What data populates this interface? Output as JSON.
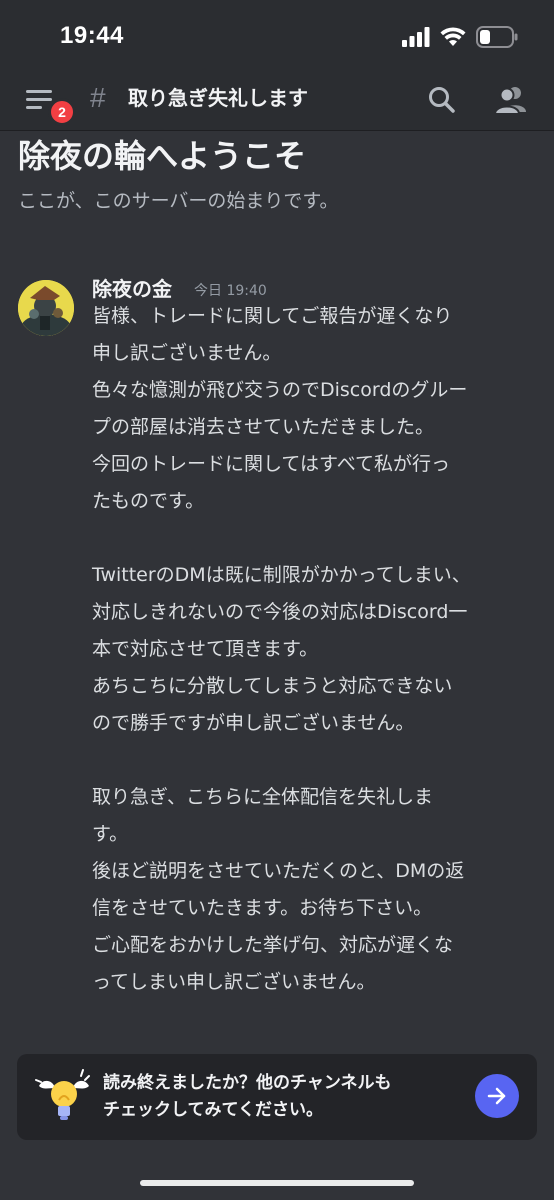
{
  "status_bar": {
    "time": "19:44"
  },
  "header": {
    "menu_badge": "2",
    "hash": "#",
    "channel_name": "取り急ぎ失礼します"
  },
  "welcome": {
    "title": "除夜の輪へようこそ",
    "subtitle": "ここが、このサーバーの始まりです。"
  },
  "message": {
    "author": "除夜の金",
    "timestamp": "今日 19:40",
    "lines": [
      "皆様、トレードに関してご報告が遅くなり",
      "申し訳ございません。",
      "色々な憶測が飛び交うのでDiscordのグルー",
      "プの部屋は消去させていただきました。",
      "今回のトレードに関してはすべて私が行っ",
      "たものです。",
      "",
      "TwitterのDMは既に制限がかかってしまい、",
      "対応しきれないので今後の対応はDiscord一",
      "本で対応させて頂きます。",
      "あちこちに分散してしまうと対応できない",
      "ので勝手ですが申し訳ございません。",
      "",
      "取り急ぎ、こちらに全体配信を失礼しま",
      "す。",
      "後ほど説明をさせていただくのと、DMの返",
      "信をさせていたきます。お待ち下さい。",
      "ご心配をおかけした挙げ句、対応が遅くな",
      "ってしまい申し訳ございません。"
    ]
  },
  "prompt": {
    "line1": "読み終えましたか？他のチャンネルも",
    "line2": "チェックしてみてください。"
  },
  "icons": {
    "menu": "hamburger-menu-icon",
    "search": "search-icon",
    "members": "members-icon",
    "next": "arrow-right-icon"
  },
  "colors": {
    "background": "#313338",
    "header": "#2b2d31",
    "badge": "#f23f43",
    "accent": "#5865f2"
  }
}
